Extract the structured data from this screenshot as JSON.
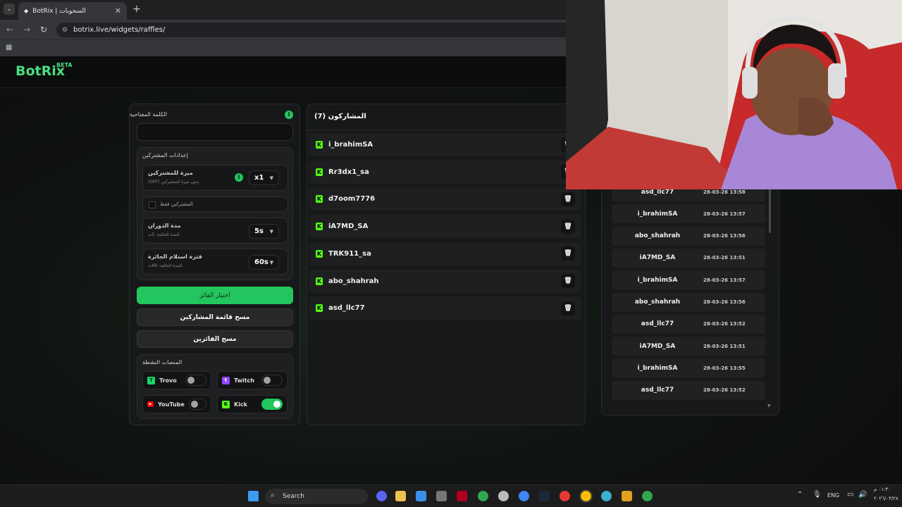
{
  "browser": {
    "tab_title": "BotRix | السحوبات",
    "url": "botrix.live/widgets/raffles/"
  },
  "logo": {
    "name": "BotRix",
    "badge": "BETA"
  },
  "settings": {
    "keyword_label": "الكلمة المفتاحية",
    "keyword_value": "",
    "subs_section_title": "إعدادات المشتركين",
    "subs_feature_label": "ميزة للمشتركين",
    "subs_feature_desc": "(OFF) بدون ميزة للمشتركين",
    "subs_feature_value": "x1",
    "subs_only_label": "المشتركين فقط",
    "spin_label": "مدة الدوران",
    "spin_desc": "المدة الحالية: 5ث",
    "spin_value": "5s",
    "claim_label": "فترة استلام الجائزة",
    "claim_desc": "المدة الحالية: 60ث",
    "claim_value": "60s",
    "pick_winner_button": "اختيار الفائز",
    "clear_participants_button": "مسح قائمة المشاركين",
    "clear_winners_button": "مسح الفائزين",
    "platforms_title": "المنصات النشطة",
    "platforms": [
      {
        "name": "Trovo",
        "on": false,
        "icon": "trovo-icon",
        "color": "#19d66b"
      },
      {
        "name": "Twitch",
        "on": false,
        "icon": "twitch-icon",
        "color": "#9146ff"
      },
      {
        "name": "YouTube",
        "on": false,
        "icon": "youtube-icon",
        "color": "#ff0000"
      },
      {
        "name": "Kick",
        "on": true,
        "icon": "kick-icon",
        "color": "#53fc18"
      }
    ]
  },
  "participants": {
    "title": "المشاركون (7)",
    "items": [
      "i_brahimSA",
      "Rr3dx1_sa",
      "d7oom7776",
      "iA7MD_SA",
      "TRK911_sa",
      "abo_shahrah",
      "asd_llc77"
    ]
  },
  "winners": [
    {
      "name": "asd_llc77",
      "time": "28-03-26 13:58"
    },
    {
      "name": "i_brahimSA",
      "time": "28-03-26 13:57"
    },
    {
      "name": "abo_shahrah",
      "time": "28-03-26 13:56"
    },
    {
      "name": "iA7MD_SA",
      "time": "28-03-26 13:51"
    },
    {
      "name": "i_brahimSA",
      "time": "28-03-26 13:57"
    },
    {
      "name": "abo_shahrah",
      "time": "28-03-26 13:56"
    },
    {
      "name": "asd_llc77",
      "time": "28-03-26 13:52"
    },
    {
      "name": "iA7MD_SA",
      "time": "28-03-26 13:51"
    },
    {
      "name": "i_brahimSA",
      "time": "28-03-26 13:55"
    },
    {
      "name": "asd_llc77",
      "time": "28-03-26 13:52"
    }
  ],
  "taskbar": {
    "search_placeholder": "Search",
    "lang": "ENG",
    "time": "٠١:٣٠ م",
    "date": "٢٠٢٦/٠٣/٢٨"
  },
  "colors": {
    "accent": "#22c55e",
    "kick": "#53fc18",
    "bg": "#0d0f10"
  }
}
